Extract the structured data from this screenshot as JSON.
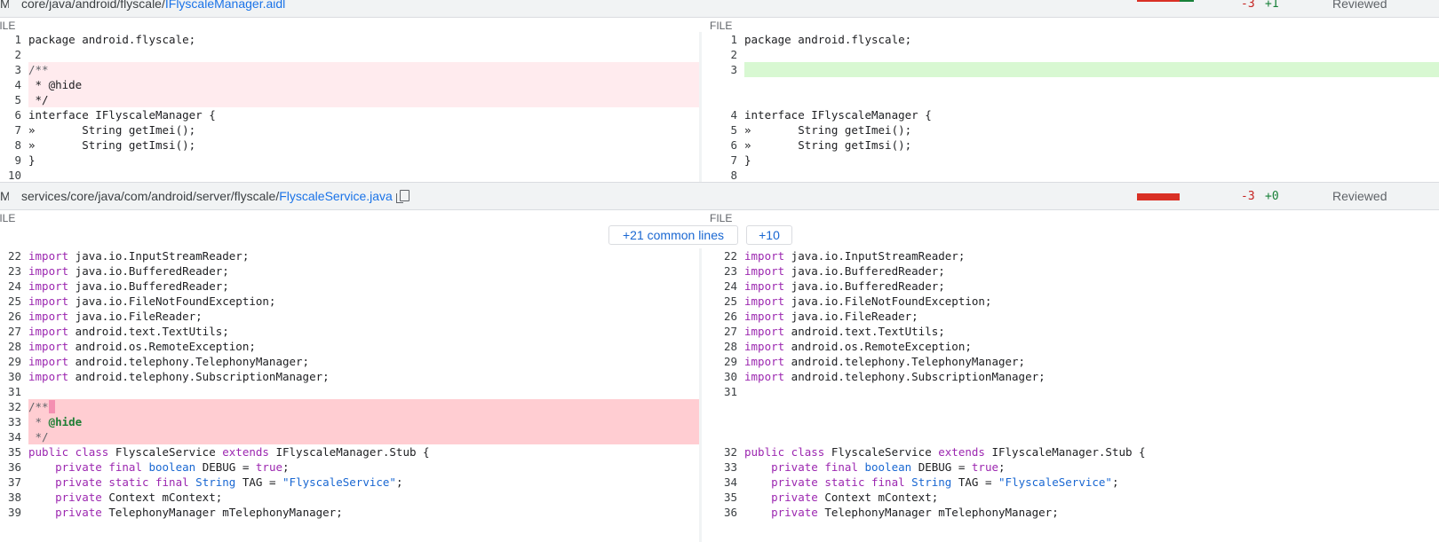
{
  "file1": {
    "status": "M",
    "path_prefix": "core/java/android/flyscale/",
    "filename": "IFlyscaleManager.aidl",
    "deletions": "-3",
    "additions": "+1",
    "review_status": "Reviewed",
    "colors": {
      "del_bar": "#d93025",
      "add_bar": "#188038"
    },
    "col_left": "FILE",
    "col_right": "FILE",
    "left_nums": [
      "1",
      "2",
      "3",
      "4",
      "5",
      "6",
      "7",
      "8",
      "9",
      "10"
    ],
    "right_nums": [
      "1",
      "2",
      "3",
      "4",
      "5",
      "6",
      "7",
      "8"
    ],
    "lines": {
      "pkg": "package android.flyscale;",
      "c_open": "/**",
      "c_hide": " * @hide",
      "c_close": " */",
      "iface": "interface IFlyscaleManager {",
      "imei": "»       String getImei();",
      "imsi": "»       String getImsi();",
      "brace": "}"
    }
  },
  "file2": {
    "status": "M",
    "path_prefix": "services/core/java/com/android/server/flyscale/",
    "filename": "FlyscaleService.java",
    "deletions": "-3",
    "additions": "+0",
    "review_status": "Reviewed",
    "col_left": "FILE",
    "col_right": "FILE",
    "expand_common": "+21 common lines",
    "expand_more": "+10",
    "left_nums": [
      "22",
      "23",
      "24",
      "25",
      "26",
      "27",
      "28",
      "29",
      "30",
      "31",
      "32",
      "33",
      "34",
      "35",
      "36",
      "37",
      "38",
      "39"
    ],
    "right_nums": [
      "22",
      "23",
      "24",
      "25",
      "26",
      "27",
      "28",
      "29",
      "30",
      "31",
      "32",
      "33",
      "34",
      "35",
      "36"
    ],
    "kw_import": "import",
    "imports": [
      " java.io.InputStreamReader;",
      " java.io.BufferedReader;",
      " java.io.BufferedReader;",
      " java.io.FileNotFoundException;",
      " java.io.FileReader;",
      " android.text.TextUtils;",
      " android.os.RemoteException;",
      " android.telephony.TelephonyManager;",
      " android.telephony.SubscriptionManager;"
    ],
    "c_open": "/**",
    "c_star": " * ",
    "c_hide": "@hide",
    "c_close": " */",
    "kw_public": "public",
    "kw_class": " class",
    "cls_name": " FlyscaleService ",
    "kw_extends": "extends",
    "cls_rest": " IFlyscaleManager.Stub {",
    "indent": "    ",
    "kw_private": "private",
    "kw_final": " final",
    "kw_static": " static",
    "ty_boolean": " boolean",
    "debug_mid": " DEBUG = ",
    "kw_true": "true",
    "semi": ";",
    "ty_string": " String",
    "tag_mid": " TAG = ",
    "tag_val": "\"FlyscaleService\"",
    "ctx_rest": " Context mContext;",
    "tm_rest": " TelephonyManager mTelephonyManager;"
  }
}
